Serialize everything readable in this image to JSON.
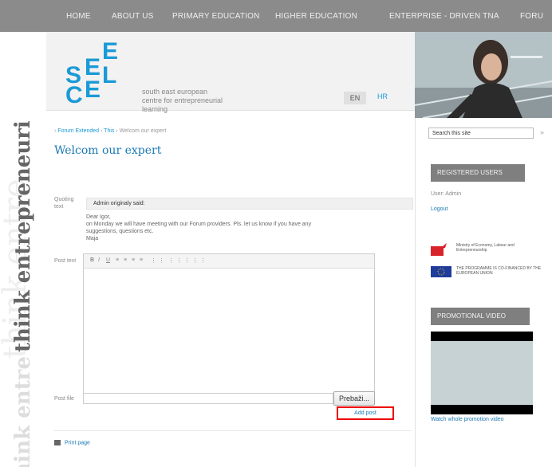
{
  "nav": {
    "items": [
      "HOME",
      "ABOUT US",
      "PRIMARY EDUCATION",
      "HIGHER EDUCATION",
      "ENTERPRISE - DRIVEN TNA",
      "FORU"
    ]
  },
  "brand": {
    "logo_letters": [
      "S",
      "E",
      "E",
      "C",
      "E",
      "L"
    ],
    "org_name": [
      "south east european",
      "centre for entrepreneurial",
      "learning"
    ],
    "vertical_dark": "think entrepreneurial",
    "vertical_light": "think entre",
    "vertical_ghost": "think entre",
    "color_accent": "#1a9ad6"
  },
  "lang": {
    "en": "EN",
    "hr": "HR"
  },
  "breadcrumb": {
    "items": [
      "Forum Extended",
      "This",
      "Welcom our expert"
    ],
    "separator": "›"
  },
  "page": {
    "title": "Welcom our expert"
  },
  "form": {
    "quoting_label": "Quoting text",
    "quote_header": "Admin originaly said:",
    "quote_lines": [
      "Dear Igor,",
      "on Monday we will have meeting with our Forum providers. Pls. let us know if you have any",
      "suggestions, questions etc.",
      "Maja"
    ],
    "post_text_label": "Post text",
    "toolbar_buttons": [
      "B",
      "I",
      "U",
      "≡",
      "≡",
      "≡",
      "≡",
      "⋮",
      "⋮",
      "⋮",
      "⋮",
      "⋮",
      "⋮",
      "⋮"
    ],
    "post_file_label": "Post file",
    "browse_label": "Prebaži...",
    "add_post_label": "Add post",
    "print_label": "Print page"
  },
  "sidebar": {
    "search_value": "Search this site",
    "search_button": "»",
    "registered_heading": "REGISTERED USERS",
    "user_text": "User: Admin",
    "logout_label": "Logout",
    "sponsor1_text": "Ministry of Economy, Labour and Entrepreneurship",
    "sponsor2_text": "THE PROGRAMME IS CO-FINANCED BY THE EUROPEAN UNION",
    "video_heading": "PROMOTIONAL VIDEO",
    "watch_label": "Watch whole promotion video"
  }
}
